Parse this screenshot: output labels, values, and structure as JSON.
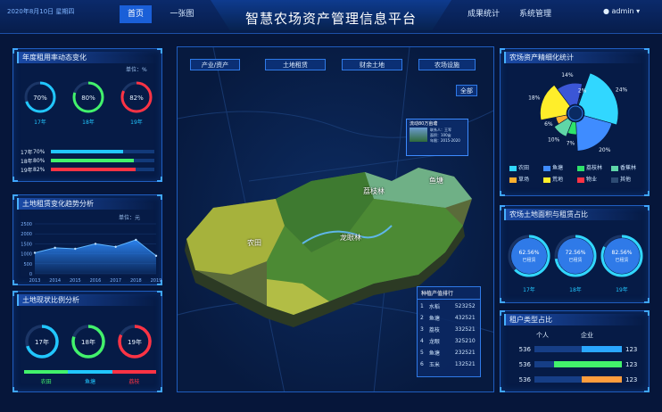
{
  "header": {
    "date": "2020年8月10日 星期四",
    "title": "智慧农场资产管理信息平台",
    "nav_left": [
      "首页",
      "一张图"
    ],
    "nav_right": [
      "成果统计",
      "系统管理"
    ],
    "user": "admin"
  },
  "panel_rental_rate": {
    "title": "年度租用率动态变化",
    "unit": "单位：%",
    "rings": [
      {
        "year": "17年",
        "pct": "70%",
        "value": 70,
        "color": "#21c7ff"
      },
      {
        "year": "18年",
        "pct": "80%",
        "value": 80,
        "color": "#42f26b"
      },
      {
        "year": "19年",
        "pct": "82%",
        "value": 82,
        "color": "#ff3344"
      }
    ],
    "bars": [
      {
        "year": "17年",
        "pct": "70%",
        "value": 70,
        "color": "#21c7ff"
      },
      {
        "year": "18年",
        "pct": "80%",
        "value": 80,
        "color": "#42f26b"
      },
      {
        "year": "19年",
        "pct": "82%",
        "value": 82,
        "color": "#ff3344"
      }
    ]
  },
  "panel_land_trend": {
    "title": "土地租赁变化趋势分析",
    "unit": "单位：元",
    "chart_data": {
      "type": "area",
      "categories": [
        "2013",
        "2014",
        "2015",
        "2016",
        "2017",
        "2018",
        "2019"
      ],
      "values": [
        1050,
        1300,
        1250,
        1500,
        1350,
        1700,
        900
      ],
      "yticks": [
        "2500",
        "2000",
        "1500",
        "1000",
        "500",
        "0"
      ],
      "ylim": [
        0,
        2500
      ]
    }
  },
  "panel_land_status": {
    "title": "土地现状比例分析",
    "rings": [
      {
        "year": "17年",
        "value": 70,
        "color": "#21c7ff"
      },
      {
        "year": "18年",
        "value": 80,
        "color": "#42f26b"
      },
      {
        "year": "19年",
        "value": 82,
        "color": "#ff3344"
      }
    ],
    "legend": [
      {
        "label": "农田",
        "color": "#42f26b"
      },
      {
        "label": "鱼塘",
        "color": "#21c7ff"
      },
      {
        "label": "荔枝",
        "color": "#ff3344"
      }
    ]
  },
  "map": {
    "tabs": [
      "产业/资产",
      "土地租赁",
      "财余土地",
      "农场设施"
    ],
    "all_button": "全部",
    "labels": [
      "荔枝林",
      "鱼塘",
      "农田",
      "龙眼林"
    ],
    "popup": {
      "title": "流动80万亩塘",
      "rows": [
        "联系人：王军",
        "面积：100亩",
        "年限：2015-2020"
      ]
    },
    "ranking": {
      "title": "种植产值排行",
      "rows": [
        {
          "rank": "1",
          "name": "水稻",
          "value": "523252"
        },
        {
          "rank": "2",
          "name": "鱼塘",
          "value": "432521"
        },
        {
          "rank": "3",
          "name": "荔枝",
          "value": "332521"
        },
        {
          "rank": "4",
          "name": "龙眼",
          "value": "325210"
        },
        {
          "rank": "5",
          "name": "鱼塘",
          "value": "232521"
        },
        {
          "rank": "6",
          "name": "玉米",
          "value": "132521"
        }
      ]
    }
  },
  "panel_asset_detail": {
    "title": "农场资产精细化统计",
    "chart_data": {
      "type": "pie",
      "labels": [
        "24%",
        "20%",
        "7%",
        "10%",
        "6%",
        "18%",
        "14%",
        "2%"
      ],
      "values": [
        24,
        20,
        7,
        10,
        6,
        18,
        14,
        2
      ],
      "colors": [
        "#31d7ff",
        "#3f8cff",
        "#2ee36a",
        "#5fd6a8",
        "#ffb02e",
        "#ffee2a",
        "#3b56d6",
        "#15365f"
      ]
    },
    "legend": [
      {
        "label": "农田",
        "color": "#31d7ff"
      },
      {
        "label": "鱼塘",
        "color": "#3f8cff"
      },
      {
        "label": "荔枝林",
        "color": "#2ee36a"
      },
      {
        "label": "香蕉林",
        "color": "#5fd6a8"
      },
      {
        "label": "草场",
        "color": "#ffb02e"
      },
      {
        "label": "荒地",
        "color": "#ffee2a"
      },
      {
        "label": "物业",
        "color": "#ff3344"
      },
      {
        "label": "其他",
        "color": "#2d4b73"
      }
    ]
  },
  "panel_area_rent": {
    "title": "农场土地面积与租赁占比",
    "rings": [
      {
        "pct": "62.56%",
        "label": "已租赁",
        "year": "17年",
        "value": 62.56
      },
      {
        "pct": "72.56%",
        "label": "已租赁",
        "year": "18年",
        "value": 72.56
      },
      {
        "pct": "82.56%",
        "label": "已租赁",
        "year": "19年",
        "value": 82.56
      }
    ]
  },
  "panel_renter_type": {
    "title": "租户类型占比",
    "headers": [
      "个人",
      "企业"
    ],
    "rows": [
      {
        "left": "536",
        "right": "123",
        "fill": 0.46,
        "color": "#2aa7ff"
      },
      {
        "left": "536",
        "right": "123",
        "fill": 0.78,
        "color": "#42f26b"
      },
      {
        "left": "536",
        "right": "123",
        "fill": 0.46,
        "color": "#ff9d3d"
      }
    ]
  }
}
